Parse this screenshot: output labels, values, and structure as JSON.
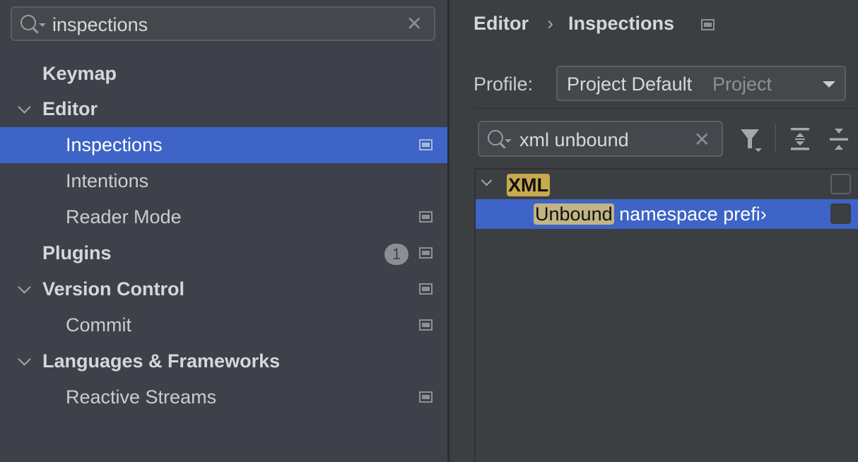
{
  "settings_search": {
    "value": "inspections"
  },
  "tree": [
    {
      "label": "Keymap",
      "bold": true
    },
    {
      "label": "Editor",
      "bold": true,
      "expanded": true
    },
    {
      "label": "Inspections",
      "selected": true
    },
    {
      "label": "Intentions"
    },
    {
      "label": "Reader Mode"
    },
    {
      "label": "Plugins",
      "bold": true,
      "badge": "1"
    },
    {
      "label": "Version Control",
      "bold": true,
      "expanded": true
    },
    {
      "label": "Commit"
    },
    {
      "label": "Languages & Frameworks",
      "bold": true,
      "expanded": true
    },
    {
      "label": "Reactive Streams"
    }
  ],
  "breadcrumb": {
    "parent": "Editor",
    "separator": "›",
    "current": "Inspections"
  },
  "profile": {
    "label": "Profile:",
    "value": "Project Default",
    "scope": "Project"
  },
  "inspection_search": {
    "value": "xml unbound"
  },
  "results": {
    "group": "XML",
    "item_highlight": "Unbound",
    "item_rest": " namespace prefi›"
  },
  "colors": {
    "selection": "#3d64c6",
    "highlight": "#c8a94f"
  }
}
